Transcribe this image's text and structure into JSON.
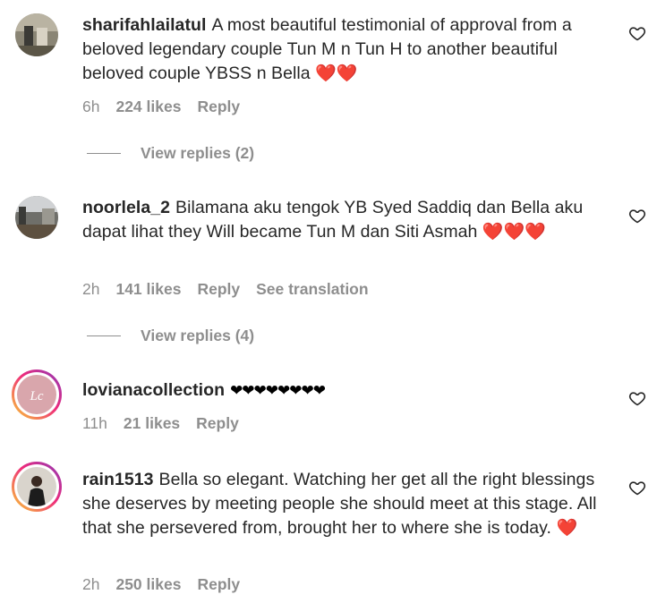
{
  "comments": [
    {
      "username": "sharifahlailatul",
      "text": "A most beautiful testimonial of approval from a beloved legendary couple Tun M n Tun H to another beautiful beloved couple YBSS n Bella",
      "emoji": "❤️❤️",
      "time": "6h",
      "likes": "224 likes",
      "reply": "Reply",
      "view_replies": "View replies (2)"
    },
    {
      "username": "noorlela_2",
      "text": "Bilamana aku tengok YB Syed Saddiq dan Bella aku dapat lihat they Will became Tun M dan Siti Asmah",
      "emoji": "❤️❤️❤️",
      "time": "2h",
      "likes": "141 likes",
      "reply": "Reply",
      "see_translation": "See translation",
      "view_replies": "View replies (4)"
    },
    {
      "username": "lovianacollection",
      "text": "",
      "emoji": "❤❤❤❤❤❤❤❤",
      "avatar_monogram": "Lc",
      "time": "11h",
      "likes": "21 likes",
      "reply": "Reply"
    },
    {
      "username": "rain1513",
      "text": "Bella so elegant. Watching her get all the right blessings she deserves by meeting people she should meet at this stage. All that she persevered from, brought her to where she is today.",
      "emoji": "❤️",
      "time": "2h",
      "likes": "250 likes",
      "reply": "Reply"
    }
  ],
  "icons": {
    "like": "heart-outline-icon"
  },
  "colors": {
    "text": "#262626",
    "meta": "#8e8e8e",
    "heart": "#e53935"
  }
}
